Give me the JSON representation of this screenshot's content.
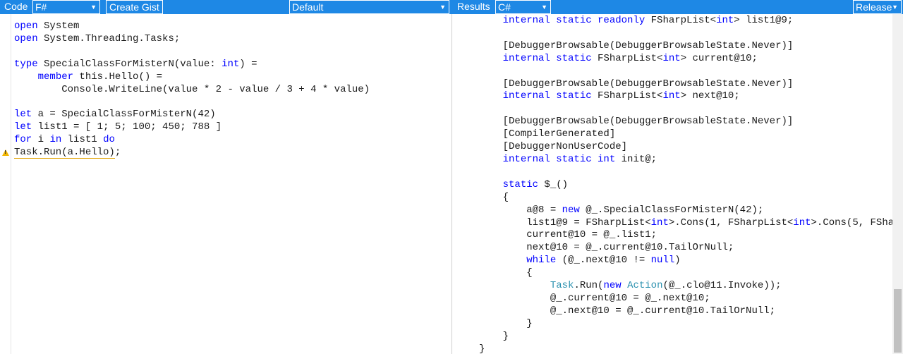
{
  "topbar": {
    "code_label": "Code",
    "language_select": "F#",
    "create_gist": "Create Gist",
    "mode_select": "Default",
    "results_label": "Results",
    "output_select": "C#",
    "config_select": "Release"
  },
  "colors": {
    "accent": "#1e88e5",
    "keyword": "#0000ff",
    "type": "#2b91af",
    "warning": "#f2b600"
  },
  "icons": {
    "warning": "warning-icon",
    "dropdown": "caret-down-icon"
  },
  "left_code": [
    "open System",
    "open System.Threading.Tasks;",
    "",
    "type SpecialClassForMisterN(value: int) =",
    "    member this.Hello() =",
    "        Console.WriteLine(value * 2 - value / 3 + 4 * value)",
    "",
    "let a = SpecialClassForMisterN(42)",
    "let list1 = [ 1; 5; 100; 450; 788 ]",
    "for i in list1 do",
    "Task.Run(a.Hello);"
  ],
  "right_code": [
    "    internal static readonly FSharpList<int> list1@9;",
    "",
    "    [DebuggerBrowsable(DebuggerBrowsableState.Never)]",
    "    internal static FSharpList<int> current@10;",
    "",
    "    [DebuggerBrowsable(DebuggerBrowsableState.Never)]",
    "    internal static FSharpList<int> next@10;",
    "",
    "    [DebuggerBrowsable(DebuggerBrowsableState.Never)]",
    "    [CompilerGenerated]",
    "    [DebuggerNonUserCode]",
    "    internal static int init@;",
    "",
    "    static $_()",
    "    {",
    "        a@8 = new @_.SpecialClassForMisterN(42);",
    "        list1@9 = FSharpList<int>.Cons(1, FSharpList<int>.Cons(5, FShar",
    "        current@10 = @_.list1;",
    "        next@10 = @_.current@10.TailOrNull;",
    "        while (@_.next@10 != null)",
    "        {",
    "            Task.Run(new Action(@_.clo@11.Invoke));",
    "            @_.current@10 = @_.next@10;",
    "            @_.next@10 = @_.current@10.TailOrNull;",
    "        }",
    "    }",
    "}"
  ]
}
